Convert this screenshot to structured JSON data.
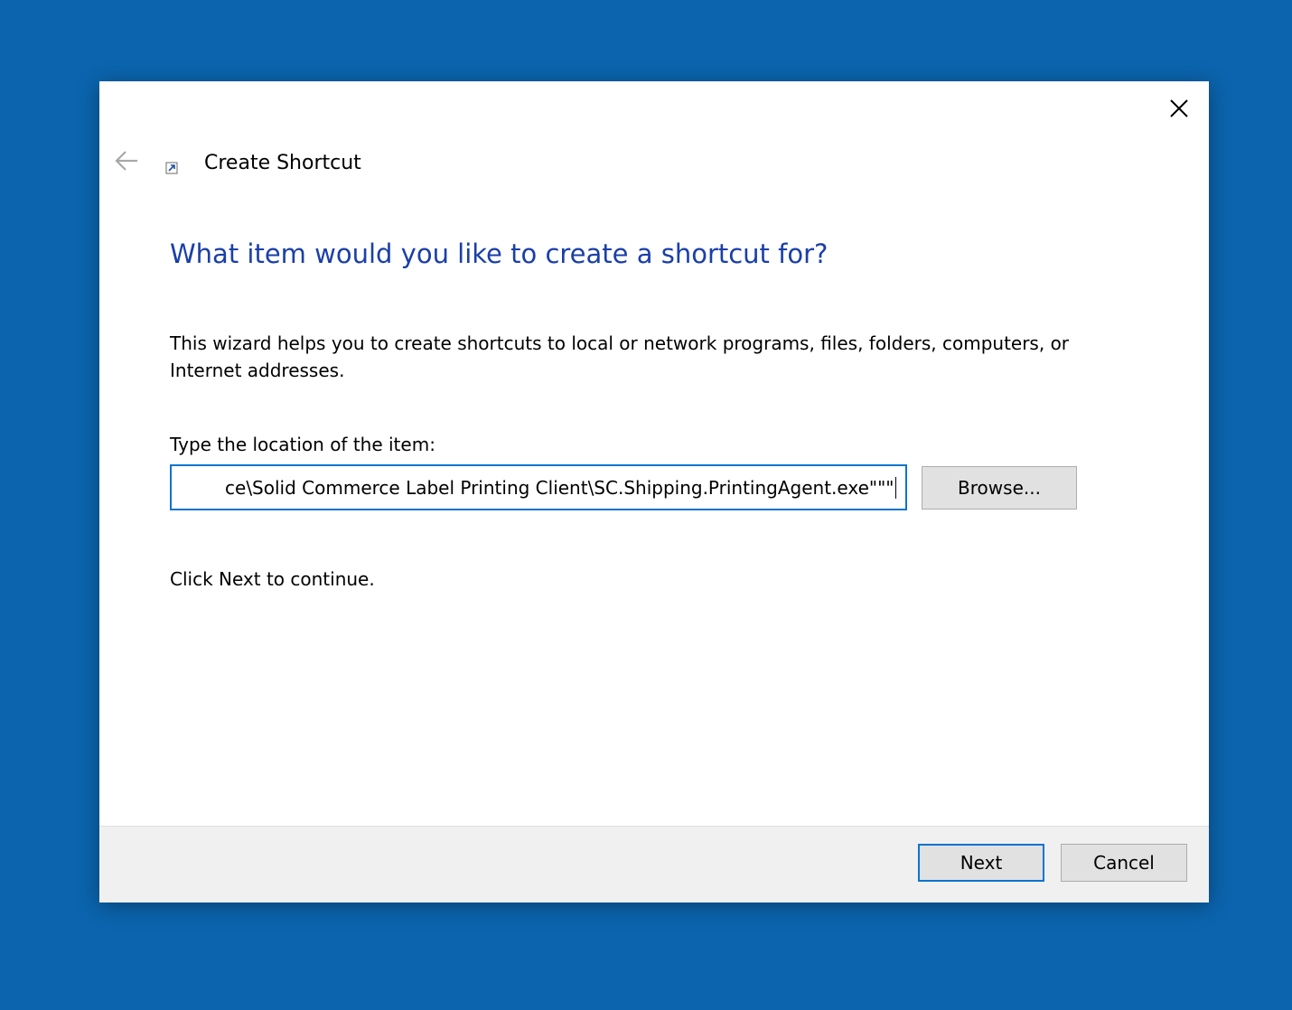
{
  "wizard": {
    "title": "Create Shortcut",
    "back_icon": "back-arrow-icon",
    "shortcut_icon": "shortcut-arrow-icon",
    "close_icon": "close-icon"
  },
  "page": {
    "heading": "What item would you like to create a shortcut for?",
    "description": "This wizard helps you to create shortcuts to local or network programs, files, folders, computers, or Internet addresses.",
    "location_label": "Type the location of the item:",
    "location_value": "ce\\Solid Commerce Label Printing Client\\SC.Shipping.PrintingAgent.exe\"\"\"",
    "browse_label": "Browse...",
    "continue_hint": "Click Next to continue."
  },
  "footer": {
    "next_label": "Next",
    "cancel_label": "Cancel"
  },
  "colors": {
    "desktop": "#0b64ad",
    "heading": "#1a3fa8",
    "focus_border": "#0a74d0",
    "footer_bg": "#f0f0f0",
    "button_bg": "#e1e1e1"
  }
}
